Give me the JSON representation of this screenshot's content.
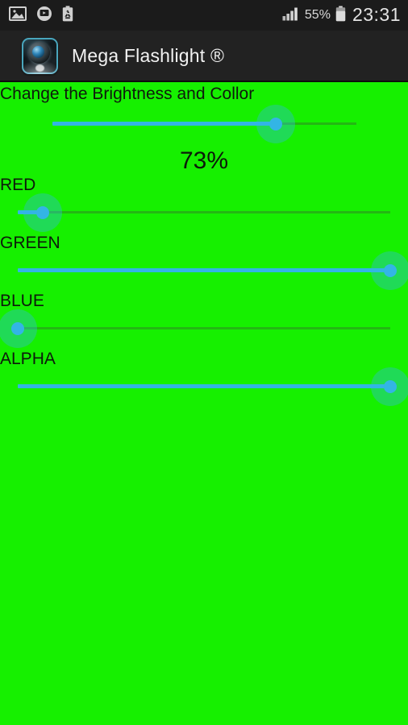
{
  "status_bar": {
    "icons": [
      "image-icon",
      "screen-recorder-icon",
      "battery-saver-icon"
    ],
    "signal_icon": "signal-bars-icon",
    "battery_percent": "55%",
    "battery_icon": "battery-icon",
    "clock": "23:31"
  },
  "action_bar": {
    "app_icon": "flashlight-app-icon",
    "title": "Mega Flashlight ®"
  },
  "content": {
    "section_title": "Change the Brightness and Collor",
    "brightness": {
      "label": "",
      "value_text": "73%",
      "percent": 73
    },
    "sliders": [
      {
        "name": "red",
        "label": "RED",
        "percent": 7,
        "fill": true
      },
      {
        "name": "green",
        "label": "GREEN",
        "percent": 100,
        "fill": true
      },
      {
        "name": "blue",
        "label": "BLUE",
        "percent": 0,
        "fill": false
      },
      {
        "name": "alpha",
        "label": "ALPHA",
        "percent": 100,
        "fill": true
      }
    ]
  },
  "colors": {
    "background_green": "#16f000",
    "accent_blue": "#33b5e5",
    "thumb_halo": "rgba(51,181,229,0.38)",
    "status_bar_bg": "#1b1b1b",
    "action_bar_bg": "#222222",
    "text_dark": "#0d1a0b",
    "text_light": "#f2f2f2"
  }
}
